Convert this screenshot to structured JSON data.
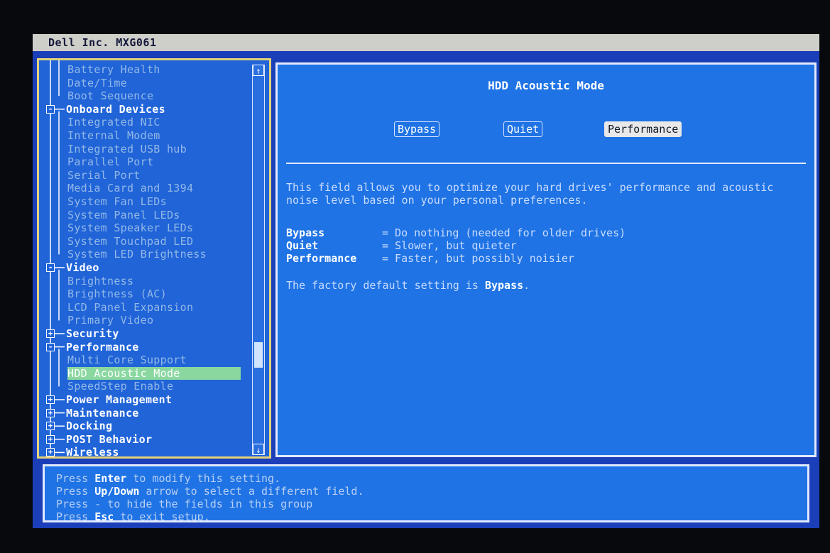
{
  "window": {
    "title": "Dell Inc. MXG061"
  },
  "tree": {
    "items": [
      {
        "label": "Battery Health",
        "type": "item"
      },
      {
        "label": "Date/Time",
        "type": "item"
      },
      {
        "label": "Boot Sequence",
        "type": "item"
      },
      {
        "label": "Onboard Devices",
        "type": "group",
        "expander": "-"
      },
      {
        "label": "Integrated NIC",
        "type": "item"
      },
      {
        "label": "Internal Modem",
        "type": "item"
      },
      {
        "label": "Integrated USB hub",
        "type": "item"
      },
      {
        "label": "Parallel Port",
        "type": "item"
      },
      {
        "label": "Serial Port",
        "type": "item"
      },
      {
        "label": "Media Card and 1394",
        "type": "item"
      },
      {
        "label": "System Fan LEDs",
        "type": "item"
      },
      {
        "label": "System Panel LEDs",
        "type": "item"
      },
      {
        "label": "System Speaker LEDs",
        "type": "item"
      },
      {
        "label": "System Touchpad LED",
        "type": "item"
      },
      {
        "label": "System LED Brightness",
        "type": "item"
      },
      {
        "label": "Video",
        "type": "group",
        "expander": "-"
      },
      {
        "label": "Brightness",
        "type": "item"
      },
      {
        "label": "Brightness (AC)",
        "type": "item"
      },
      {
        "label": "LCD Panel Expansion",
        "type": "item"
      },
      {
        "label": "Primary Video",
        "type": "item"
      },
      {
        "label": "Security",
        "type": "group",
        "expander": "+"
      },
      {
        "label": "Performance",
        "type": "group",
        "expander": "-"
      },
      {
        "label": "Multi Core Support",
        "type": "item"
      },
      {
        "label": "HDD Acoustic Mode",
        "type": "item",
        "selected": true
      },
      {
        "label": "SpeedStep Enable",
        "type": "item"
      },
      {
        "label": "Power Management",
        "type": "group",
        "expander": "+"
      },
      {
        "label": "Maintenance",
        "type": "group",
        "expander": "+"
      },
      {
        "label": "Docking",
        "type": "group",
        "expander": "+"
      },
      {
        "label": "POST Behavior",
        "type": "group",
        "expander": "+"
      },
      {
        "label": "Wireless",
        "type": "group",
        "expander": "+"
      }
    ],
    "scroll_up": "↑",
    "scroll_down": "↓",
    "scroll_position": 0.78
  },
  "setting": {
    "title": "HDD Acoustic Mode",
    "options": [
      {
        "label": "Bypass",
        "active": false
      },
      {
        "label": "Quiet",
        "active": false
      },
      {
        "label": "Performance",
        "active": true
      }
    ],
    "description": "This field allows you to optimize your hard drives' performance and acoustic noise level based on your personal preferences.",
    "definitions": [
      {
        "term": "Bypass",
        "text": "= Do nothing (needed for older drives)"
      },
      {
        "term": "Quiet",
        "text": "= Slower, but quieter"
      },
      {
        "term": "Performance",
        "text": "= Faster, but possibly noisier"
      }
    ],
    "default_prefix": "The factory default setting is ",
    "default_value": "Bypass",
    "default_suffix": "."
  },
  "help": {
    "lines": [
      {
        "pre": "Press ",
        "key": "Enter",
        "post": " to modify this setting."
      },
      {
        "pre": "Press ",
        "key": "Up/Down",
        "post": " arrow to select a different field."
      },
      {
        "pre": "Press - to hide the fields in this group",
        "key": "",
        "post": ""
      },
      {
        "pre": "Press ",
        "key": "Esc",
        "post": " to exit setup."
      }
    ]
  },
  "colors": {
    "screen_bg": "#1a3fb8",
    "panel_bg": "#1f73e4",
    "tree_bg": "#2064d8",
    "tree_border": "#e3d27a",
    "selection": "#8ad8a0",
    "title_bar": "#cfcfca"
  }
}
